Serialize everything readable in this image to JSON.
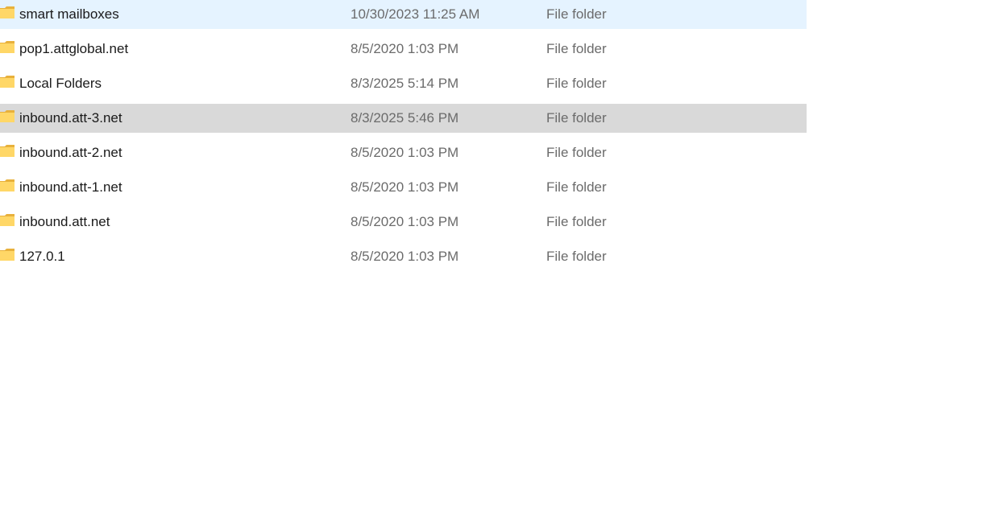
{
  "rows": [
    {
      "name": "smart mailboxes",
      "date": "10/30/2023 11:25 AM",
      "type": "File folder",
      "icon": "folder-icon",
      "state": "hover"
    },
    {
      "name": "pop1.attglobal.net",
      "date": "8/5/2020 1:03 PM",
      "type": "File folder",
      "icon": "folder-icon",
      "state": "normal"
    },
    {
      "name": "Local Folders",
      "date": "8/3/2025 5:14 PM",
      "type": "File folder",
      "icon": "folder-icon",
      "state": "normal"
    },
    {
      "name": "inbound.att-3.net",
      "date": "8/3/2025 5:46 PM",
      "type": "File folder",
      "icon": "folder-icon",
      "state": "selected"
    },
    {
      "name": "inbound.att-2.net",
      "date": "8/5/2020 1:03 PM",
      "type": "File folder",
      "icon": "folder-icon",
      "state": "normal"
    },
    {
      "name": "inbound.att-1.net",
      "date": "8/5/2020 1:03 PM",
      "type": "File folder",
      "icon": "folder-icon",
      "state": "normal"
    },
    {
      "name": "inbound.att.net",
      "date": "8/5/2020 1:03 PM",
      "type": "File folder",
      "icon": "folder-icon",
      "state": "normal"
    },
    {
      "name": "127.0.1",
      "date": "8/5/2020 1:03 PM",
      "type": "File folder",
      "icon": "folder-icon",
      "state": "normal"
    }
  ],
  "colors": {
    "hover_row": "#e5f3ff",
    "selected_row": "#d9d9d9",
    "folder_fill": "#ffd767",
    "folder_dark": "#e8b13c",
    "text_primary": "#1a1a1a",
    "text_secondary": "#6b6b6b"
  }
}
